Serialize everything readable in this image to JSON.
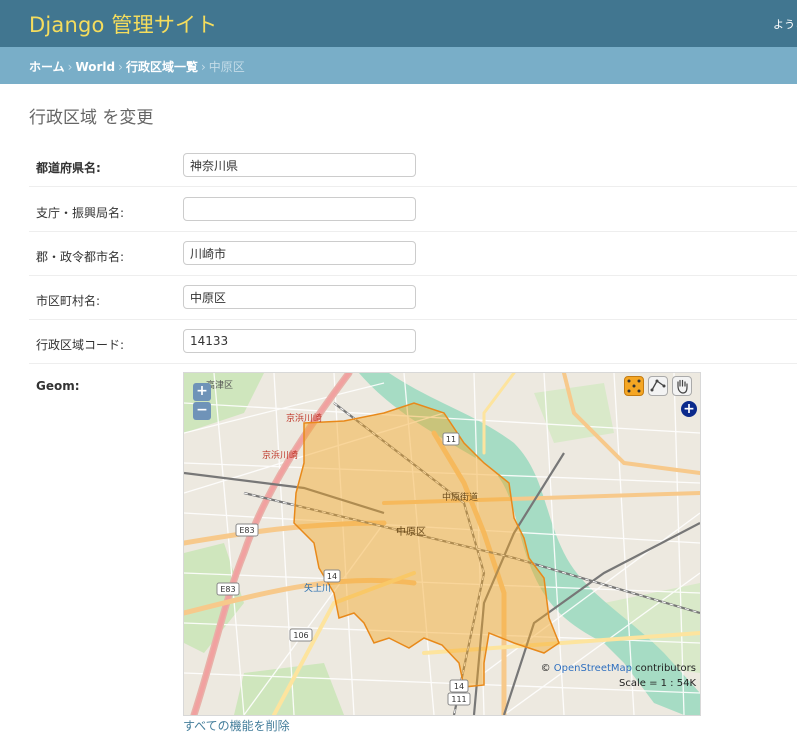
{
  "header": {
    "site_name": "Django 管理サイト",
    "user_tools": "ようこそ"
  },
  "breadcrumbs": {
    "home": "ホーム",
    "app": "World",
    "model": "行政区域一覧",
    "current": "中原区",
    "separator": "›"
  },
  "page": {
    "title": "行政区域 を変更"
  },
  "form": {
    "fields": [
      {
        "label": "都道府県名:",
        "value": "神奈川県",
        "required": true
      },
      {
        "label": "支庁・振興局名:",
        "value": "",
        "required": false
      },
      {
        "label": "郡・政令都市名:",
        "value": "川崎市",
        "required": false
      },
      {
        "label": "市区町村名:",
        "value": "中原区",
        "required": false
      },
      {
        "label": "行政区域コード:",
        "value": "14133",
        "required": false
      }
    ],
    "geom_label": "Geom:"
  },
  "map": {
    "zoom_in": "+",
    "zoom_out": "−",
    "layer_switcher": "+",
    "attribution_prefix": "© ",
    "attribution_link": "OpenStreetMap",
    "attribution_suffix": " contributors",
    "scale": "Scale = 1 : 54K",
    "labels": {
      "station_takatsu": "高津区",
      "line_keihin1": "京浜川崎",
      "line_keihin2": "京浜川崎",
      "line_nakahara": "中原区",
      "road_e83_a": "E83",
      "road_e83_b": "E83",
      "road_11": "11",
      "road_14": "14",
      "road_106": "106",
      "road_14b": "14",
      "road_111": "111",
      "river_yagami": "矢上川",
      "road_nakahara_kaido": "中原街道"
    },
    "polygon_color": "#f5a623",
    "river_color": "#a6dcc4"
  },
  "actions": {
    "delete_all": "すべての機能を削除"
  }
}
